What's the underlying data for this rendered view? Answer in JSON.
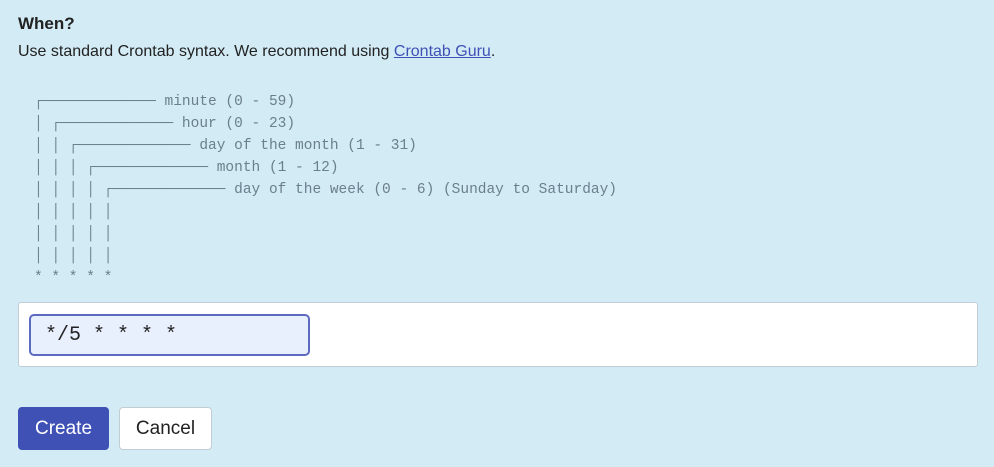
{
  "section": {
    "title": "When?",
    "description_prefix": "Use standard Crontab syntax. We recommend using ",
    "link_text": "Crontab Guru",
    "description_suffix": "."
  },
  "diagram": {
    "text": "┌───────────── minute (0 - 59)\n│ ┌───────────── hour (0 - 23)\n│ │ ┌───────────── day of the month (1 - 31)\n│ │ │ ┌───────────── month (1 - 12)\n│ │ │ │ ┌───────────── day of the week (0 - 6) (Sunday to Saturday)\n│ │ │ │ │\n│ │ │ │ │\n│ │ │ │ │\n* * * * *"
  },
  "cron_input": {
    "value": "*/5 * * * *"
  },
  "actions": {
    "create_label": "Create",
    "cancel_label": "Cancel"
  }
}
